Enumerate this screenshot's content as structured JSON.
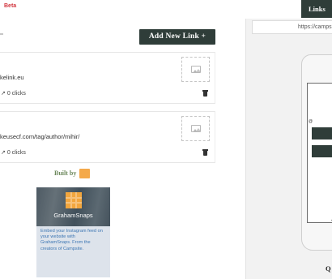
{
  "header": {
    "beta_label": "Beta",
    "tab_label": "Links"
  },
  "main": {
    "add_button_label": "Add New Link +",
    "links": [
      {
        "url": "kelink.eu",
        "clicks": "0 clicks"
      },
      {
        "url": "keusecf.com/tag/author/mihir/",
        "clicks": "0 clicks"
      }
    ],
    "footer": {
      "built_by_label": "Built by",
      "promo": {
        "name": "GrahamSnaps",
        "description": "Embed your Instagram feed on your website with GrahamSnaps. From the creators of Campsite."
      }
    }
  },
  "preview": {
    "url": "https://camps",
    "partial_letter": "Q"
  },
  "colors": {
    "accent_dark": "#2f3d39",
    "beta_red": "#d2353e",
    "built_by_green": "#6e8a5e",
    "brand_orange": "#f4a94a",
    "promo_link_blue": "#3d76b3"
  }
}
